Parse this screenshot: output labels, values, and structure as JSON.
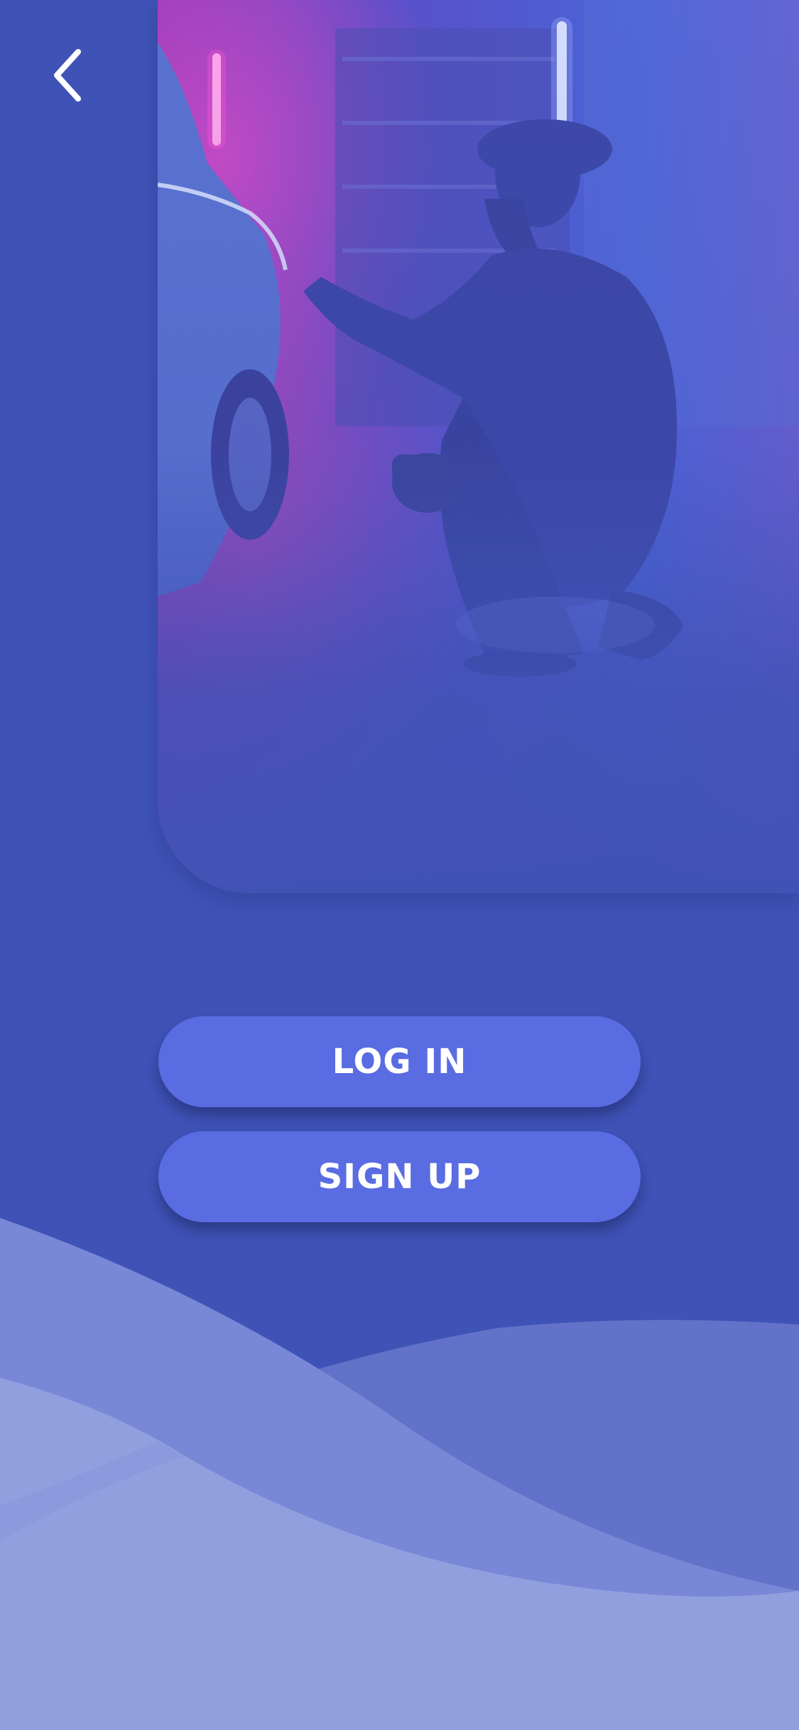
{
  "header": {
    "back_icon": "chevron-left-icon"
  },
  "hero": {
    "image_description_icon": "mechanic-garage-photo"
  },
  "actions": {
    "login_label": "LOG IN",
    "signup_label": "SIGN UP"
  },
  "colors": {
    "background": "#3f53b7",
    "button": "#5a6ce2",
    "button_text": "#ffffff",
    "wave_light": "#919fdf",
    "wave_mid": "#7a8ad8",
    "wave_dark": "#6171c8"
  }
}
